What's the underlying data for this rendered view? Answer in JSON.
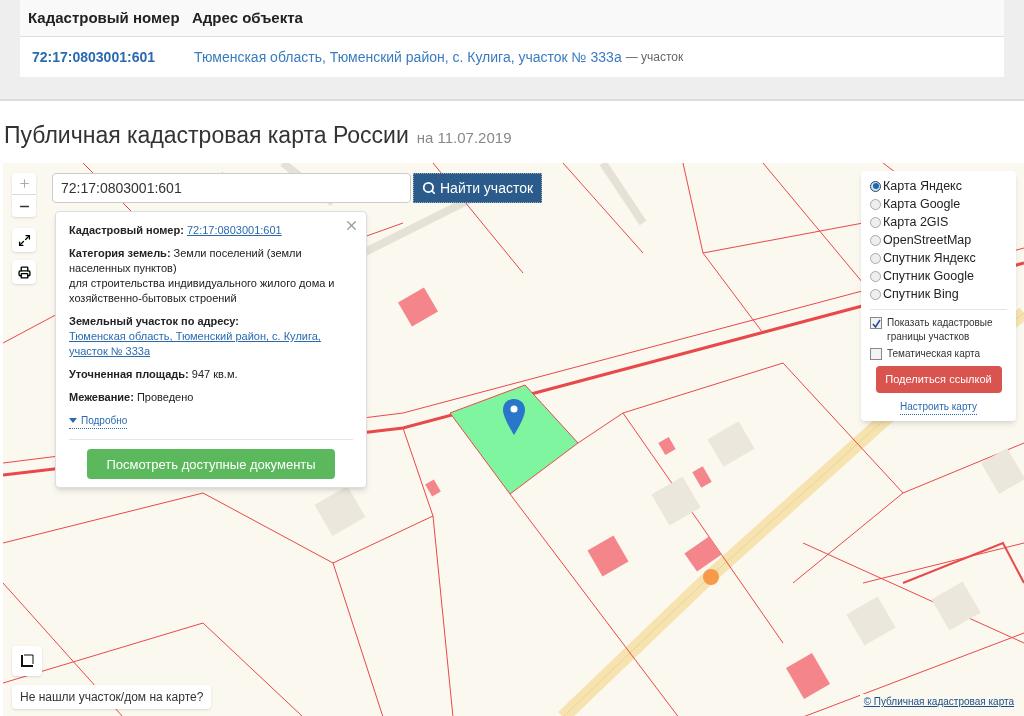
{
  "results_table": {
    "columns": [
      "Кадастровый номер",
      "Адрес объекта"
    ],
    "rows": [
      {
        "cadastral_number": "72:17:0803001:601",
        "address": "Тюменская область, Тюменский район, с. Кулига, участок № 333а",
        "object_type": "— участок"
      }
    ]
  },
  "heading": {
    "title": "Публичная кадастровая карта России",
    "date": "на 11.07.2019"
  },
  "map": {
    "search": {
      "value": "72:17:0803001:601",
      "button": "Найти участок"
    },
    "info_popup": {
      "fields": [
        {
          "kind": "link",
          "label": "Кадастровый номер:",
          "value": "72:17:0803001:601"
        },
        {
          "kind": "text",
          "label": "Категория земель:",
          "value": "Земли поселений (земли населенных пунктов)",
          "note": "для строительства индивидуального жилого дома и хозяйственно-бытовых строений"
        },
        {
          "kind": "link",
          "label": "Земельный участок по адресу:",
          "value": "Тюменская область, Тюменский район, с. Кулига, участок № 333а"
        },
        {
          "kind": "text",
          "label": "Уточненная площадь:",
          "value": "947 кв.м."
        },
        {
          "kind": "text",
          "label": "Межевание:",
          "value": "Проведено"
        }
      ],
      "details_link": "Подробно",
      "documents_button": "Посмотреть доступные документы"
    },
    "layers": [
      {
        "label": "Карта Яндекс",
        "selected": true
      },
      {
        "label": "Карта Google",
        "selected": false
      },
      {
        "label": "Карта 2GIS",
        "selected": false
      },
      {
        "label": "OpenStreetMap",
        "selected": false
      },
      {
        "label": "Спутник Яндекс",
        "selected": false
      },
      {
        "label": "Спутник Google",
        "selected": false
      },
      {
        "label": "Спутник Bing",
        "selected": false
      }
    ],
    "options": [
      {
        "label": "Показать кадастровые границы участков",
        "checked": true
      },
      {
        "label": "Тематическая карта",
        "checked": false
      }
    ],
    "share_button": "Поделиться ссылкой",
    "configure_link": "Настроить карту",
    "not_found_button": "Не нашли участок/дом на карте?",
    "attribution": "© Публичная кадастровая карта"
  }
}
